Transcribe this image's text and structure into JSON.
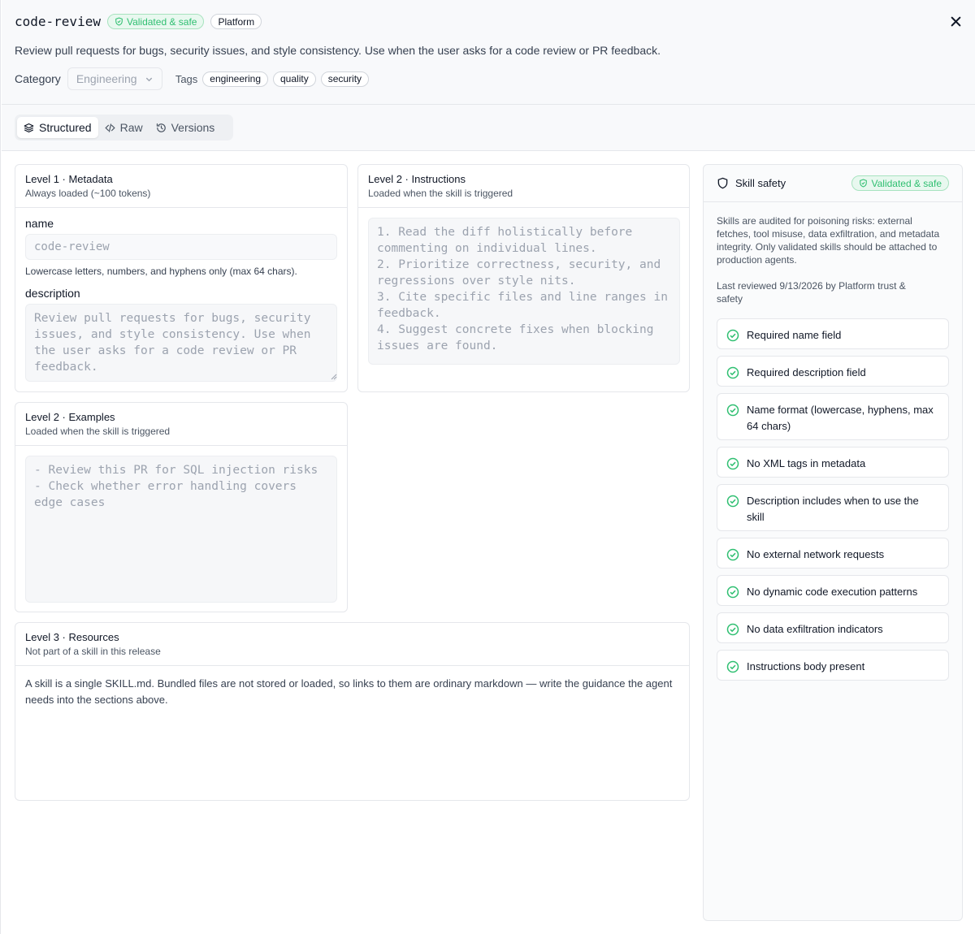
{
  "header": {
    "title": "code-review",
    "badge_safe": "Validated & safe",
    "badge_platform": "Platform",
    "description": "Review pull requests for bugs, security issues, and style consistency. Use when the user asks for a code review or PR feedback.",
    "category_label": "Category",
    "category_value": "Engineering",
    "tags_label": "Tags",
    "tags": [
      "engineering",
      "quality",
      "security"
    ]
  },
  "tabs": [
    {
      "label": "Structured",
      "icon": "layers-icon",
      "active": true
    },
    {
      "label": "Raw",
      "icon": "code-icon",
      "active": false
    },
    {
      "label": "Versions",
      "icon": "history-icon",
      "active": false
    }
  ],
  "metadata": {
    "title": "Level 1 · Metadata",
    "subtitle": "Always loaded (~100 tokens)",
    "name_label": "name",
    "name_value": "code-review",
    "name_hint": "Lowercase letters, numbers, and hyphens only (max 64 chars).",
    "description_label": "description",
    "description_value": "Review pull requests for bugs, security issues, and style consistency. Use when the user asks for a code review or PR feedback."
  },
  "instructions": {
    "title": "Level 2 · Instructions",
    "subtitle": "Loaded when the skill is triggered",
    "body": "1. Read the diff holistically before commenting on individual lines.\n2. Prioritize correctness, security, and regressions over style nits.\n3. Cite specific files and line ranges in feedback.\n4. Suggest concrete fixes when blocking issues are found."
  },
  "examples": {
    "title": "Level 2 · Examples",
    "subtitle": "Loaded when the skill is triggered",
    "body": "- Review this PR for SQL injection risks\n- Check whether error handling covers edge cases"
  },
  "resources": {
    "title": "Level 3 · Resources",
    "subtitle": "Not part of a skill in this release",
    "body": "A skill is a single SKILL.md. Bundled files are not stored or loaded, so links to them are ordinary markdown — write the guidance the agent needs into the sections above."
  },
  "safety": {
    "title": "Skill safety",
    "badge": "Validated & safe",
    "intro": "Skills are audited for poisoning risks: external fetches, tool misuse, data exfiltration, and metadata integrity. Only validated skills should be attached to production agents.",
    "reviewed": "Last reviewed 9/13/2026 by Platform trust & safety",
    "checks": [
      "Required name field",
      "Required description field",
      "Name format (lowercase, hyphens, max 64 chars)",
      "No XML tags in metadata",
      "Description includes when to use the skill",
      "No external network requests",
      "No dynamic code execution patterns",
      "No data exfiltration indicators",
      "Instructions body present"
    ]
  },
  "colors": {
    "accent_green": "#2fbf71",
    "panel_bg": "#f8f9fb",
    "border": "#e5e7eb"
  }
}
